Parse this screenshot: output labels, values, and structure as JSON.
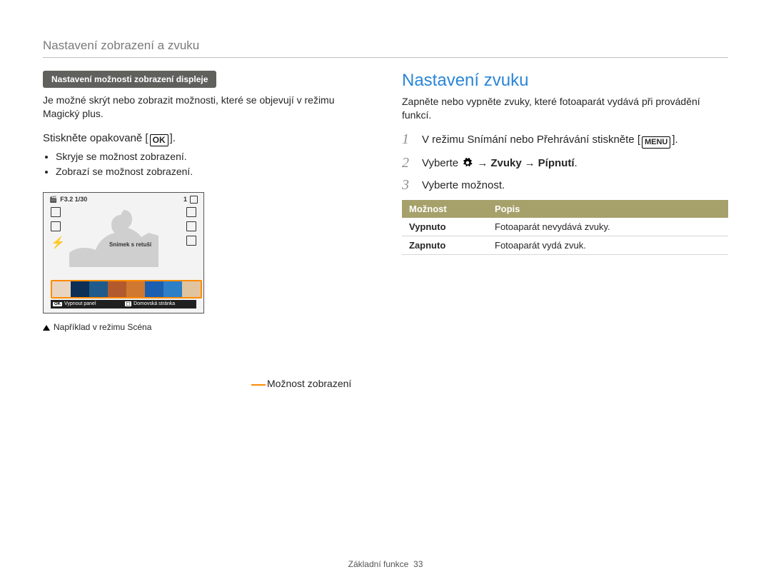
{
  "pageTitle": "Nastavení zobrazení a zvuku",
  "left": {
    "pill": "Nastavení možnosti zobrazení displeje",
    "intro": "Je možné skrýt nebo zobrazit možnosti, které se objevují v režimu Magický plus.",
    "pressLabel": "Stiskněte opakovaně [",
    "pressLabelEnd": "].",
    "okLabel": "OK",
    "bullets": [
      "Skryje se možnost zobrazení.",
      "Zobrazí se možnost zobrazení."
    ],
    "screenshot": {
      "topLeft": "F3.2 1/30",
      "topRight": "1",
      "badge": "Snímek s retuší",
      "panelOffKey": "OK",
      "panelOff": "Vypnout panel",
      "home": "Domovská stránka"
    },
    "callout": "Možnost zobrazení",
    "caption": "Například v režimu Scéna"
  },
  "right": {
    "heading": "Nastavení zvuku",
    "intro": "Zapněte nebo vypněte zvuky, které fotoaparát vydává při provádění funkcí.",
    "steps": [
      {
        "pre": "V režimu Snímání nebo Přehrávání stiskněte [",
        "menu": "MENU",
        "post": "]."
      },
      {
        "pre": "Vyberte ",
        "gear": true,
        "path": [
          "Zvuky",
          "Pípnutí"
        ],
        "post": "."
      },
      {
        "pre": "Vyberte možnost.",
        "post": ""
      }
    ],
    "table": {
      "head": [
        "Možnost",
        "Popis"
      ],
      "rows": [
        [
          "Vypnuto",
          "Fotoaparát nevydává zvuky."
        ],
        [
          "Zapnuto",
          "Fotoaparát vydá zvuk."
        ]
      ]
    }
  },
  "footer": {
    "label": "Základní funkce",
    "page": "33"
  }
}
